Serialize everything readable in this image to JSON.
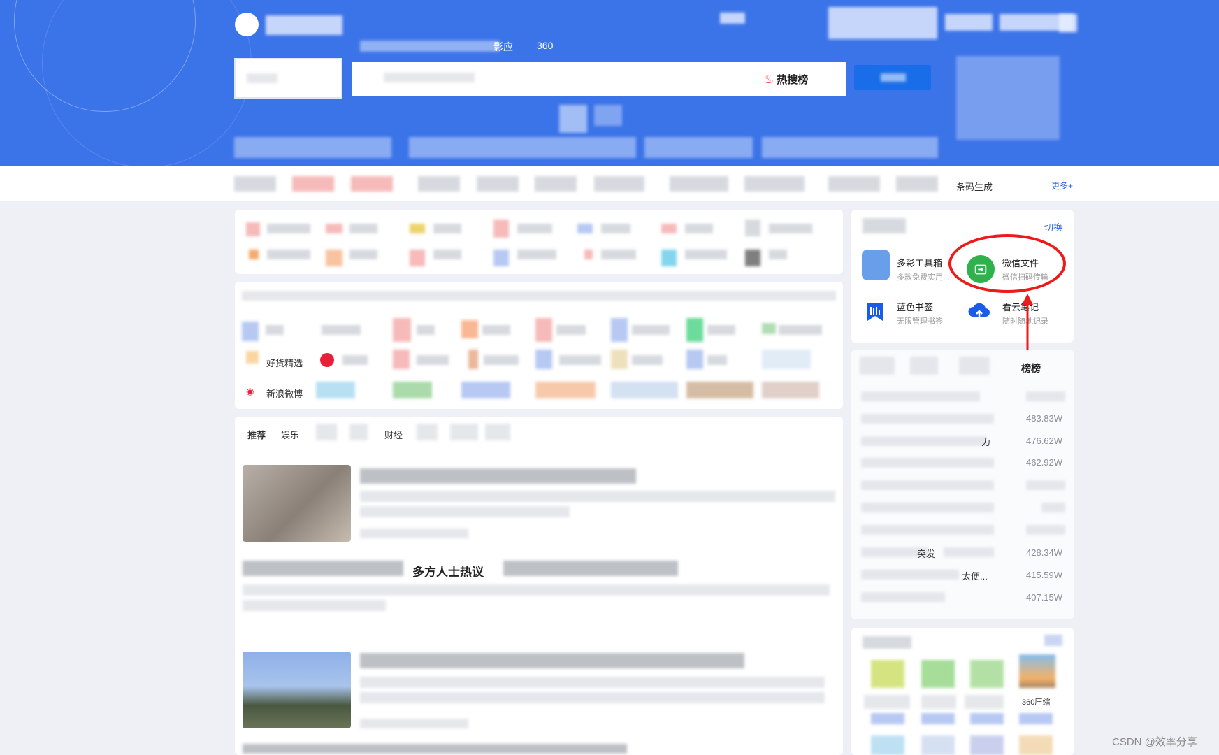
{
  "header": {
    "top_tabs": [
      "影应",
      "360"
    ],
    "hot_search_label": "热搜榜",
    "search_placeholder": ""
  },
  "quickbar": {
    "visible_item": "条码生成",
    "more_label": "更多+"
  },
  "tools_card": {
    "switch_label": "切换",
    "tools": [
      {
        "name": "多彩工具箱",
        "desc": "多款免费实用...",
        "icon": "toolbox-icon"
      },
      {
        "name": "微信文件",
        "desc": "微信扫码传输",
        "icon": "wechat-transfer-icon",
        "color": "#2fb24c"
      },
      {
        "name": "蓝色书签",
        "desc": "无限管理书签",
        "icon": "bookmark-icon",
        "color": "#1a5be8"
      },
      {
        "name": "看云笔记",
        "desc": "随时随地记录",
        "icon": "cloud-upload-icon",
        "color": "#1a5be8"
      }
    ]
  },
  "hot_rank": {
    "title": "榜榜",
    "rows": [
      {
        "text": "",
        "value": ""
      },
      {
        "text": "",
        "value": "483.83W"
      },
      {
        "text": "力",
        "value": "476.62W"
      },
      {
        "text": "",
        "value": "462.92W"
      },
      {
        "text": "",
        "value": ""
      },
      {
        "text": "",
        "value": ""
      },
      {
        "text": "",
        "value": ""
      },
      {
        "text": "突发",
        "value": "428.34W"
      },
      {
        "text": "太便...",
        "value": "415.59W"
      },
      {
        "text": "",
        "value": "407.15W"
      }
    ]
  },
  "sites": {
    "row3_label": "好货精选",
    "row4_label": "新浪微博"
  },
  "feed": {
    "tabs": [
      "推荐",
      "娱乐",
      "财经"
    ],
    "headline_fragment": "多方人士热议"
  },
  "apps_card": {
    "app_label": "360压缩"
  },
  "highlight_color": "#ec1a1a",
  "watermark": "CSDN @效率分享"
}
